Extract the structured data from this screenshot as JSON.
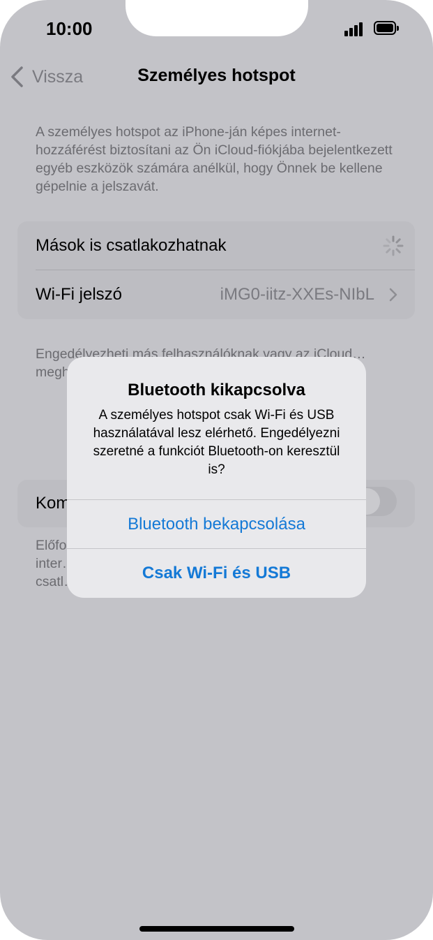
{
  "status_bar": {
    "time": "10:00"
  },
  "nav": {
    "back_label": "Vissza",
    "title": "Személyes hotspot"
  },
  "intro_text": "A személyes hotspot az iPhone-ján képes internet-hozzáférést biztosítani az Ön iCloud-fiókjába bejelentkezett egyéb eszközök számára anélkül, hogy Önnek be kellene gépelnie a jelszavát.",
  "settings": {
    "allow_others_label": "Mások is csatlakozhatnak",
    "wifi_password_label": "Wi-Fi jelszó",
    "wifi_password_value": "iMG0-iitz-XXEs-NIbL"
  },
  "footer_text": "Engedélyezheti más felhasználóknak vagy az iCloud… megh… megn… azt beka…",
  "compat": {
    "label": "Kom",
    "toggle_on": false
  },
  "bottom_text": "Előfo… inter… csatl…",
  "alert": {
    "title": "Bluetooth kikapcsolva",
    "message": "A személyes hotspot csak Wi-Fi és USB használatával lesz elérhető. Engedélyezni szeretné a funkciót Bluetooth-on keresztül is?",
    "button_enable": "Bluetooth bekapcsolása",
    "button_wifi_usb": "Csak Wi-Fi és USB"
  },
  "colors": {
    "accent": "#1479d6",
    "background": "#c3c3c8",
    "alert_bg": "#e9e9ec"
  }
}
